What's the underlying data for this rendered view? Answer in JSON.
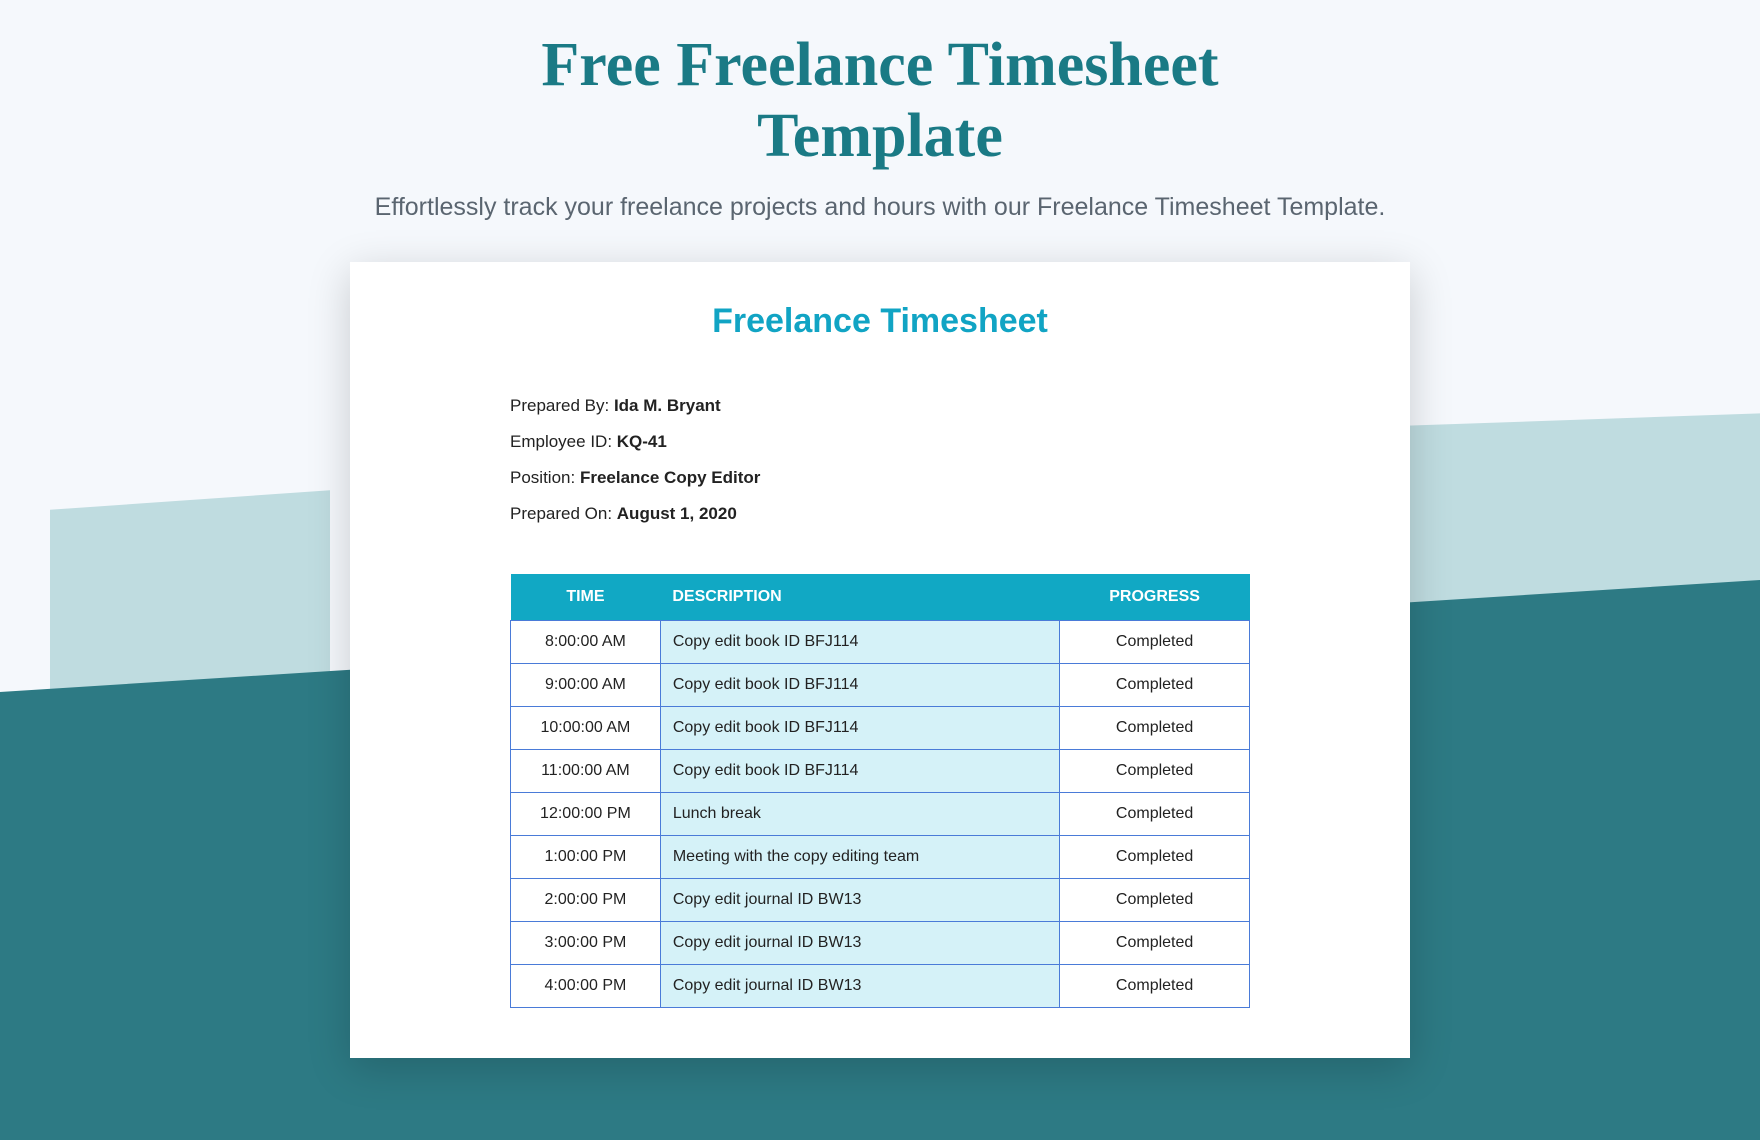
{
  "header": {
    "title_line1": "Free Freelance Timesheet",
    "title_line2": "Template",
    "subtitle": "Effortlessly track your freelance projects and hours with our Freelance Timesheet Template."
  },
  "card": {
    "title": "Freelance Timesheet",
    "meta": {
      "prepared_by_label": "Prepared By: ",
      "prepared_by": "Ida M. Bryant",
      "employee_id_label": "Employee ID: ",
      "employee_id": "KQ-41",
      "position_label": "Position: ",
      "position": "Freelance Copy Editor",
      "prepared_on_label": "Prepared On: ",
      "prepared_on": "August 1, 2020"
    },
    "columns": {
      "time": "TIME",
      "description": "DESCRIPTION",
      "progress": "PROGRESS"
    },
    "rows": [
      {
        "time": "8:00:00 AM",
        "description": "Copy edit book ID BFJ114",
        "progress": "Completed"
      },
      {
        "time": "9:00:00 AM",
        "description": "Copy edit book ID BFJ114",
        "progress": "Completed"
      },
      {
        "time": "10:00:00 AM",
        "description": "Copy edit book ID BFJ114",
        "progress": "Completed"
      },
      {
        "time": "11:00:00 AM",
        "description": "Copy edit book ID BFJ114",
        "progress": "Completed"
      },
      {
        "time": "12:00:00 PM",
        "description": "Lunch break",
        "progress": "Completed"
      },
      {
        "time": "1:00:00 PM",
        "description": "Meeting with the copy editing team",
        "progress": "Completed"
      },
      {
        "time": "2:00:00 PM",
        "description": "Copy edit journal ID BW13",
        "progress": "Completed"
      },
      {
        "time": "3:00:00 PM",
        "description": "Copy edit journal ID BW13",
        "progress": "Completed"
      },
      {
        "time": "4:00:00 PM",
        "description": "Copy edit journal ID BW13",
        "progress": "Completed"
      }
    ]
  }
}
